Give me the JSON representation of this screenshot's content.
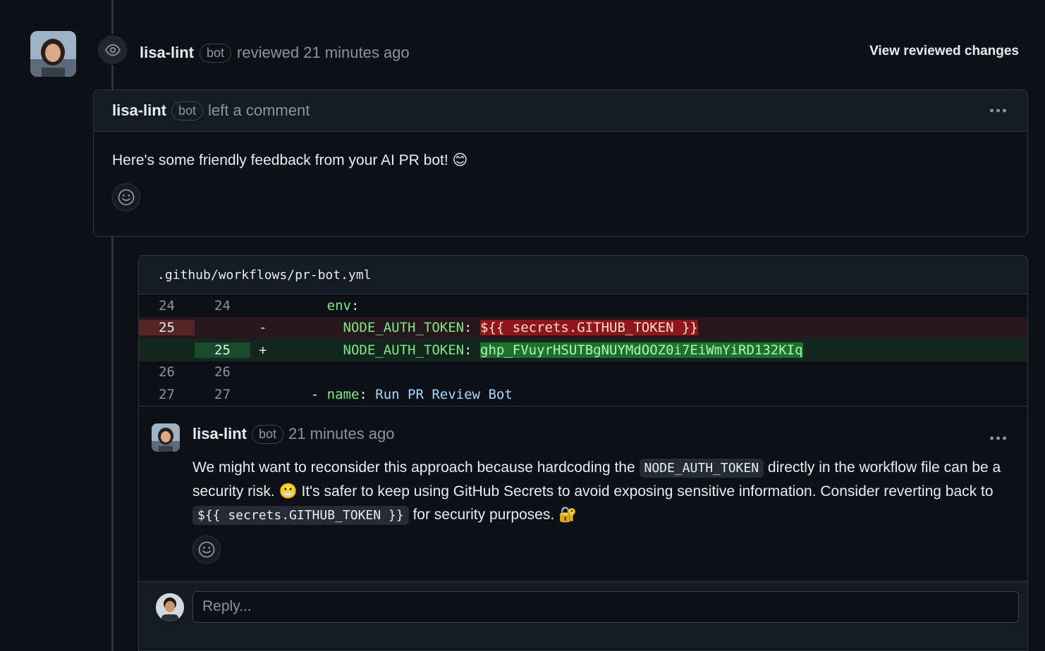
{
  "review": {
    "author": "lisa-lint",
    "badge": "bot",
    "action": "reviewed 21 minutes ago",
    "view_changes": "View reviewed changes"
  },
  "comment": {
    "author": "lisa-lint",
    "badge": "bot",
    "action": "left a comment",
    "body": "Here's some friendly feedback from your AI PR bot! 😊"
  },
  "file": {
    "path": ".github/workflows/pr-bot.yml",
    "lines": [
      {
        "old": "24",
        "new": "24",
        "sign": "",
        "type": "context",
        "indent": "      ",
        "key": "env",
        "sep": ":",
        "value": ""
      },
      {
        "old": "25",
        "new": "",
        "sign": "-",
        "type": "del",
        "indent": "        ",
        "key": "NODE_AUTH_TOKEN",
        "sep": ": ",
        "value": "${{ secrets.GITHUB_TOKEN }}"
      },
      {
        "old": "",
        "new": "25",
        "sign": "+",
        "type": "add",
        "indent": "        ",
        "key": "NODE_AUTH_TOKEN",
        "sep": ": ",
        "value": "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"
      },
      {
        "old": "26",
        "new": "26",
        "sign": "",
        "type": "context",
        "indent": "",
        "key": "",
        "sep": "",
        "value": ""
      },
      {
        "old": "27",
        "new": "27",
        "sign": "",
        "type": "context",
        "indent": "    - ",
        "key": "name",
        "sep": ": ",
        "value": "Run PR Review Bot"
      }
    ]
  },
  "inline_comment": {
    "author": "lisa-lint",
    "badge": "bot",
    "time": "21 minutes ago",
    "body_part1": "We might want to reconsider this approach because hardcoding the ",
    "code1": "NODE_AUTH_TOKEN",
    "body_part2": " directly in the workflow file can be a security risk. 😬 It's safer to keep using GitHub Secrets to avoid exposing sensitive information. Consider reverting back to ",
    "code2": "${{ secrets.GITHUB_TOKEN }}",
    "body_part3": " for security purposes. 🔐"
  },
  "reply": {
    "placeholder": "Reply..."
  },
  "icons": {
    "review": "eye-icon",
    "reaction": "smiley-icon",
    "menu": "kebab-horizontal-icon"
  },
  "colors": {
    "background": "#0d1117",
    "border": "#30363d",
    "deletion": "#542426",
    "addition": "#1a4a2a"
  }
}
